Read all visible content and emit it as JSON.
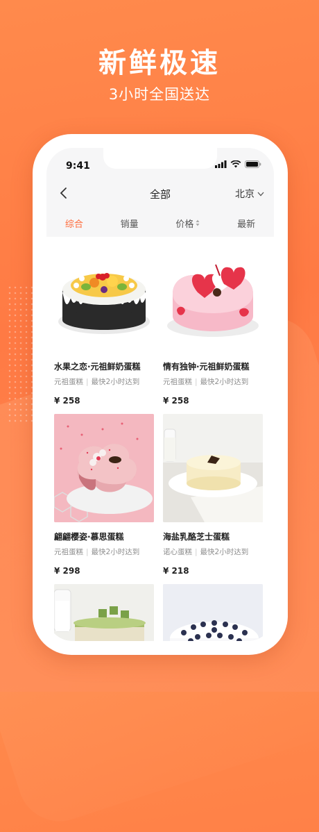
{
  "promo": {
    "headline": "新鲜极速",
    "subline": "3小时全国送达"
  },
  "status": {
    "time": "9:41"
  },
  "nav": {
    "title": "全部",
    "city": "北京"
  },
  "tabs": [
    {
      "label": "综合",
      "active": true
    },
    {
      "label": "销量",
      "active": false
    },
    {
      "label": "价格",
      "active": false,
      "sortable": true
    },
    {
      "label": "最新",
      "active": false
    }
  ],
  "products": [
    {
      "name": "水果之恋·元祖鲜奶蛋糕",
      "brand": "元祖蛋糕",
      "delivery": "最快2小时达到",
      "price": "¥ 258"
    },
    {
      "name": "情有独钟·元祖鲜奶蛋糕",
      "brand": "元祖蛋糕",
      "delivery": "最快2小时达到",
      "price": "¥ 258"
    },
    {
      "name": "翩翩樱姿·慕思蛋糕",
      "brand": "元祖蛋糕",
      "delivery": "最快2小时达到",
      "price": "¥ 298"
    },
    {
      "name": "海盐乳酪芝士蛋糕",
      "brand": "诺心蛋糕",
      "delivery": "最快2小时达到",
      "price": "¥ 218"
    },
    {
      "name": "",
      "brand": "",
      "delivery": "",
      "price": ""
    },
    {
      "name": "",
      "brand": "",
      "delivery": "",
      "price": ""
    }
  ],
  "colors": {
    "accent": "#ff6b3a",
    "background": "#ff8a4c"
  }
}
